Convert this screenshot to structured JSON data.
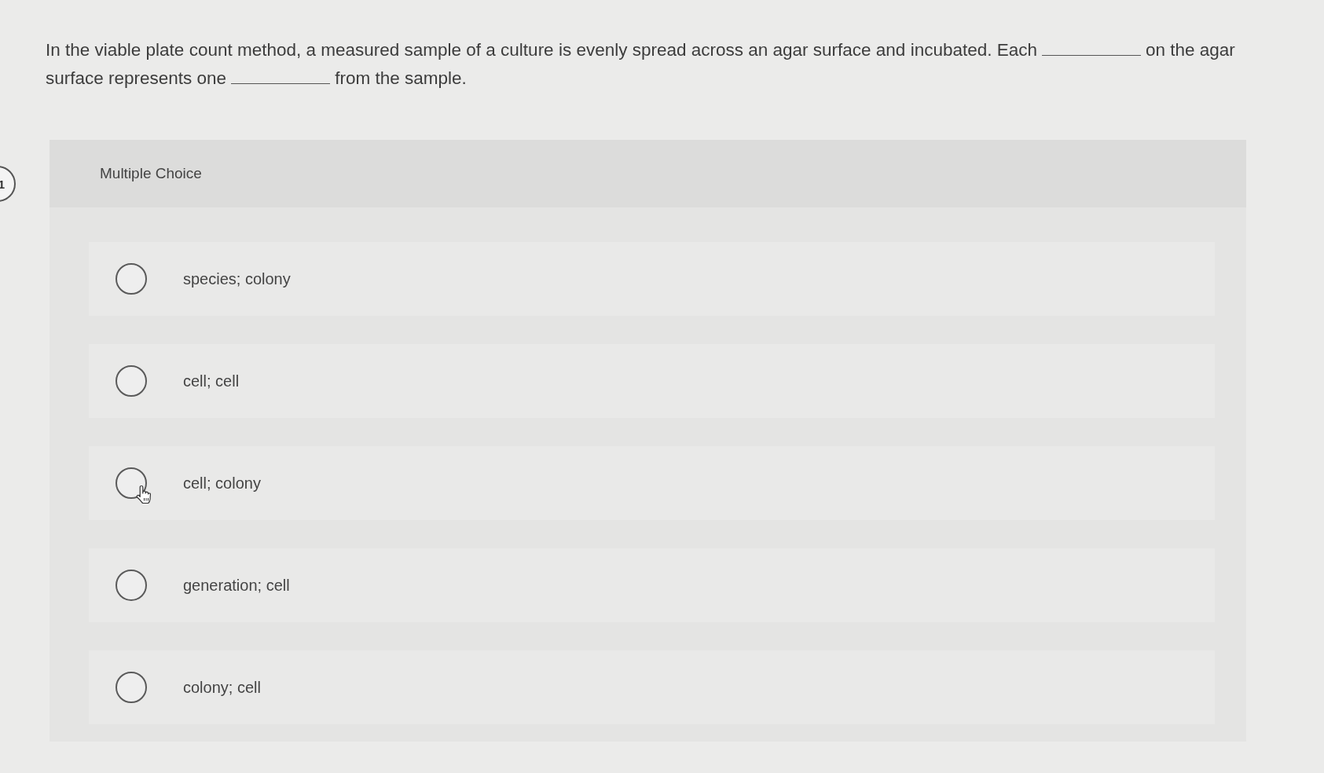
{
  "question_number": "1",
  "prompt": [
    {
      "kind": "text",
      "text": "In the viable plate count method, a measured sample of a culture is evenly spread across an agar surface and incubated. Each"
    },
    {
      "kind": "blank"
    },
    {
      "kind": "text",
      "text": "on the agar"
    },
    {
      "kind": "text",
      "text": "surface represents one"
    },
    {
      "kind": "blank"
    },
    {
      "kind": "text",
      "text": "from the sample."
    }
  ],
  "panel": {
    "title": "Multiple Choice",
    "options": [
      {
        "label": "species; colony",
        "selected": false,
        "hovered": false
      },
      {
        "label": "cell; cell",
        "selected": false,
        "hovered": false
      },
      {
        "label": "cell; colony",
        "selected": false,
        "hovered": true
      },
      {
        "label": "generation; cell",
        "selected": false,
        "hovered": false
      },
      {
        "label": "colony; cell",
        "selected": false,
        "hovered": false
      }
    ]
  }
}
